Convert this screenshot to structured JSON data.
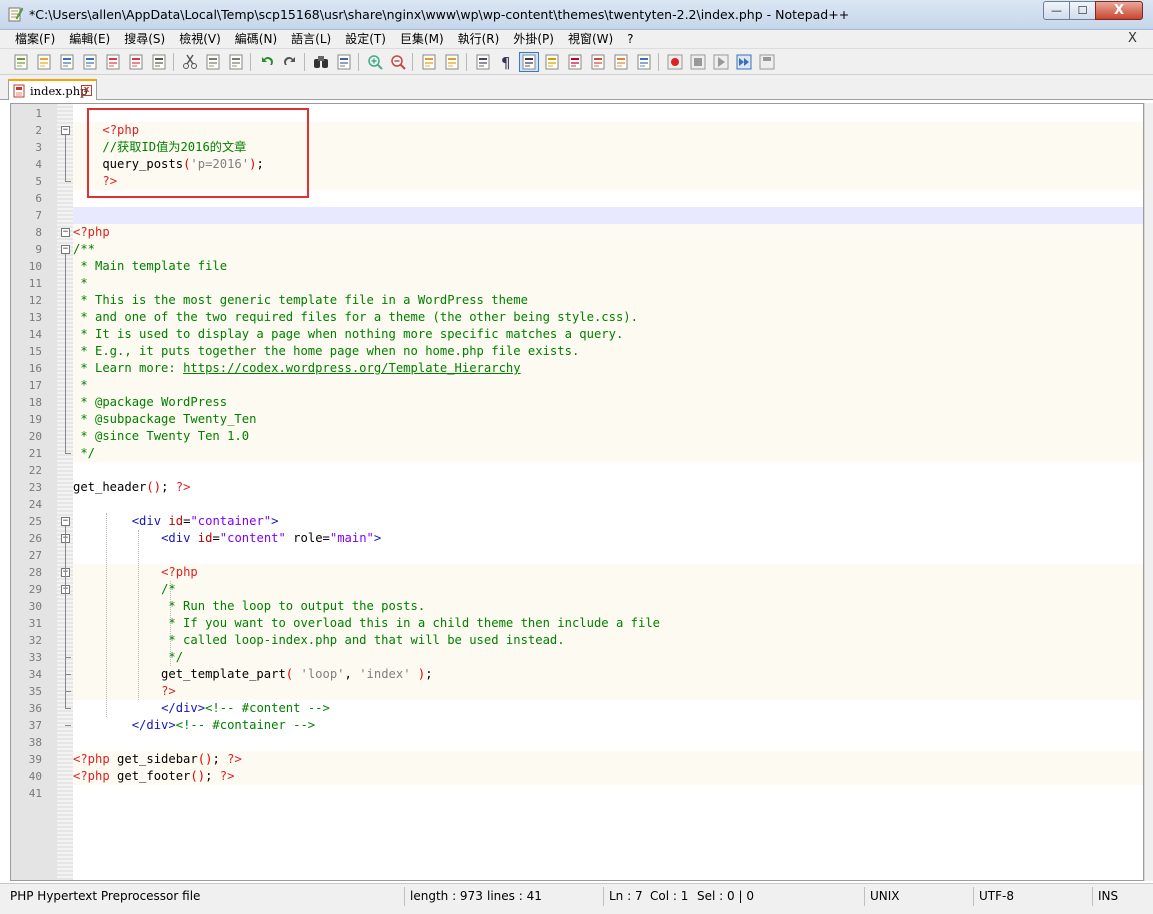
{
  "window": {
    "title": "*C:\\Users\\allen\\AppData\\Local\\Temp\\scp15168\\usr\\share\\nginx\\www\\wp\\wp-content\\themes\\twentyten-2.2\\index.php - Notepad++",
    "min_label": "—",
    "max_label": "☐",
    "close_label": "X",
    "accent_colors": {
      "title_bar": "#c6d6ea",
      "close": "#c9452f",
      "tab_marker": "#f7a400",
      "annotation": "#e03030"
    }
  },
  "menu": {
    "items": [
      {
        "label": "檔案(F)"
      },
      {
        "label": "編輯(E)"
      },
      {
        "label": "搜尋(S)"
      },
      {
        "label": "檢視(V)"
      },
      {
        "label": "編碼(N)"
      },
      {
        "label": "語言(L)"
      },
      {
        "label": "設定(T)"
      },
      {
        "label": "巨集(M)"
      },
      {
        "label": "執行(R)"
      },
      {
        "label": "外掛(P)"
      },
      {
        "label": "視窗(W)"
      },
      {
        "label": "?"
      }
    ],
    "close_label": "X"
  },
  "toolbar": {
    "icons": [
      "new-file-icon",
      "open-file-icon",
      "save-icon",
      "save-all-icon",
      "close-icon",
      "close-all-icon",
      "print-icon",
      "cut-icon",
      "copy-icon",
      "paste-icon",
      "undo-icon",
      "redo-icon",
      "find-icon",
      "replace-icon",
      "zoom-in-icon",
      "zoom-out-icon",
      "sync-vertical-icon",
      "sync-horizontal-icon",
      "word-wrap-icon",
      "show-all-chars-icon",
      "indent-guide-icon",
      "user-language-icon",
      "document-map-icon",
      "function-list-icon",
      "folder-workspace-icon",
      "monitoring-icon",
      "record-macro-icon",
      "stop-macro-icon",
      "play-macro-icon",
      "run-macro-multiple-icon",
      "save-macro-icon"
    ]
  },
  "tabs": [
    {
      "label": "index.php",
      "close": "x"
    }
  ],
  "editor": {
    "lines": [
      {
        "n": "1",
        "html": ""
      },
      {
        "n": "2",
        "html": "    <span class='tphp'>&lt;?php</span>"
      },
      {
        "n": "3",
        "html": "    <span class='tcom'>//获取ID值为2016的文章</span>"
      },
      {
        "n": "4",
        "html": "    query_posts<span class='tpunc'>(</span><span class='tstr'>'p=2016'</span><span class='tpunc'>)</span>;"
      },
      {
        "n": "5",
        "html": "    <span class='tphp'>?&gt;</span>"
      },
      {
        "n": "6",
        "html": ""
      },
      {
        "n": "7",
        "html": ""
      },
      {
        "n": "8",
        "html": "<span class='tphp'>&lt;?php</span>"
      },
      {
        "n": "9",
        "html": "<span class='tcom'>/**</span>"
      },
      {
        "n": "10",
        "html": "<span class='tcom'> * Main template file</span>"
      },
      {
        "n": "11",
        "html": "<span class='tcom'> *</span>"
      },
      {
        "n": "12",
        "html": "<span class='tcom'> * This is the most generic template file in a WordPress theme</span>"
      },
      {
        "n": "13",
        "html": "<span class='tcom'> * and one of the two required files for a theme (the other being style.css).</span>"
      },
      {
        "n": "14",
        "html": "<span class='tcom'> * It is used to display a page when nothing more specific matches a query.</span>"
      },
      {
        "n": "15",
        "html": "<span class='tcom'> * E.g., it puts together the home page when no home.php file exists.</span>"
      },
      {
        "n": "16",
        "html": "<span class='tcom'> * Learn more: </span><span class='tlink'>https://codex.wordpress.org/Template_Hierarchy</span>"
      },
      {
        "n": "17",
        "html": "<span class='tcom'> *</span>"
      },
      {
        "n": "18",
        "html": "<span class='tcom'> * @package WordPress</span>"
      },
      {
        "n": "19",
        "html": "<span class='tcom'> * @subpackage Twenty_Ten</span>"
      },
      {
        "n": "20",
        "html": "<span class='tcom'> * @since Twenty Ten 1.0</span>"
      },
      {
        "n": "21",
        "html": "<span class='tcom'> */</span>"
      },
      {
        "n": "22",
        "html": ""
      },
      {
        "n": "23",
        "html": "get_header<span class='tpunc'>()</span>; <span class='tphp'>?&gt;</span>"
      },
      {
        "n": "24",
        "html": ""
      },
      {
        "n": "25",
        "html": "        <span class='ttag'>&lt;div</span> <span class='tattr'>id</span>=<span class='tval'>\"container\"</span><span class='ttag'>&gt;</span>"
      },
      {
        "n": "26",
        "html": "            <span class='ttag'>&lt;div</span> <span class='tattr'>id</span>=<span class='tval'>\"content\"</span> role=<span class='tval'>\"main\"</span><span class='ttag'>&gt;</span>"
      },
      {
        "n": "27",
        "html": ""
      },
      {
        "n": "28",
        "html": "            <span class='tphp'>&lt;?php</span>"
      },
      {
        "n": "29",
        "html": "            <span class='tcom'>/*</span>"
      },
      {
        "n": "30",
        "html": "<span class='tcom'>             * Run the loop to output the posts.</span>"
      },
      {
        "n": "31",
        "html": "<span class='tcom'>             * If you want to overload this in a child theme then include a file</span>"
      },
      {
        "n": "32",
        "html": "<span class='tcom'>             * called loop-index.php and that will be used instead.</span>"
      },
      {
        "n": "33",
        "html": "<span class='tcom'>             */</span>"
      },
      {
        "n": "34",
        "html": "            get_template_part<span class='tpunc'>(</span> <span class='tstr'>'loop'</span>, <span class='tstr'>'index'</span> <span class='tpunc'>)</span>;"
      },
      {
        "n": "35",
        "html": "            <span class='tphp'>?&gt;</span>"
      },
      {
        "n": "36",
        "html": "            <span class='ttag'>&lt;/div&gt;</span><span class='thcom'>&lt;!-- #content --&gt;</span>"
      },
      {
        "n": "37",
        "html": "        <span class='ttag'>&lt;/div&gt;</span><span class='thcom'>&lt;!-- #container --&gt;</span>"
      },
      {
        "n": "38",
        "html": ""
      },
      {
        "n": "39",
        "html": "<span class='tphp'>&lt;?php</span> get_sidebar<span class='tpunc'>()</span>; <span class='tphp'>?&gt;</span>"
      },
      {
        "n": "40",
        "html": "<span class='tphp'>&lt;?php</span> get_footer<span class='tpunc'>()</span>; <span class='tphp'>?&gt;</span>"
      },
      {
        "n": "41",
        "html": ""
      }
    ]
  },
  "status": {
    "file_type": "PHP Hypertext Preprocessor file",
    "length": "length : 973",
    "lines": "lines : 41",
    "ln": "Ln : 7",
    "col": "Col : 1",
    "sel": "Sel : 0 | 0",
    "eol": "UNIX",
    "encoding": "UTF-8",
    "mode": "INS"
  }
}
